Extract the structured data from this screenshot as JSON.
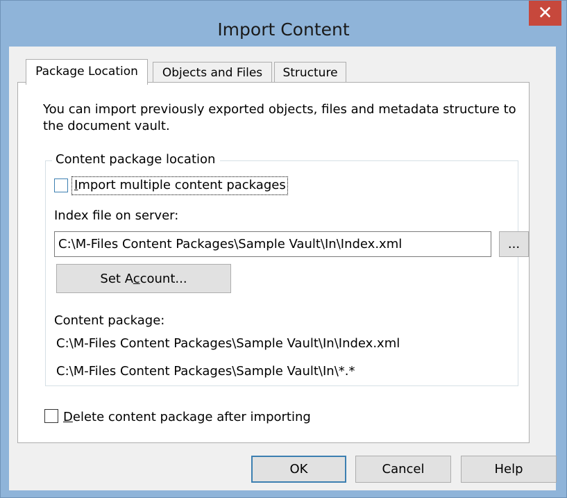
{
  "window": {
    "title": "Import Content",
    "close_glyph": "✕",
    "colors": {
      "titlebar": "#8fb4d9",
      "close": "#c7483c",
      "accent": "#3c7fb1"
    }
  },
  "tabs": [
    {
      "label": "Package Location",
      "active": true
    },
    {
      "label": "Objects and Files",
      "active": false
    },
    {
      "label": "Structure",
      "active": false
    }
  ],
  "intro_line1": "You can import previously exported objects, files and metadata structure to",
  "intro_line2": "the document vault.",
  "group": {
    "title": "Content package location",
    "multi_checkbox": {
      "pre": "",
      "accel": "I",
      "post": "mport multiple content packages",
      "checked": false
    },
    "index_label": {
      "pre": "Index f",
      "accel": "i",
      "post": "le on server:"
    },
    "index_value": "C:\\M-Files Content Packages\\Sample Vault\\In\\Index.xml",
    "browse_label": "...",
    "set_account": {
      "pre": "Set A",
      "accel": "c",
      "post": "count..."
    },
    "package_label": "Content package:",
    "package_lines": [
      "C:\\M-Files Content Packages\\Sample Vault\\In\\Index.xml",
      "C:\\M-Files Content Packages\\Sample Vault\\In\\*.*"
    ]
  },
  "delete_checkbox": {
    "pre": "",
    "accel": "D",
    "post": "elete content package after importing",
    "checked": false
  },
  "buttons": {
    "ok": "OK",
    "cancel": "Cancel",
    "help": "Help"
  }
}
